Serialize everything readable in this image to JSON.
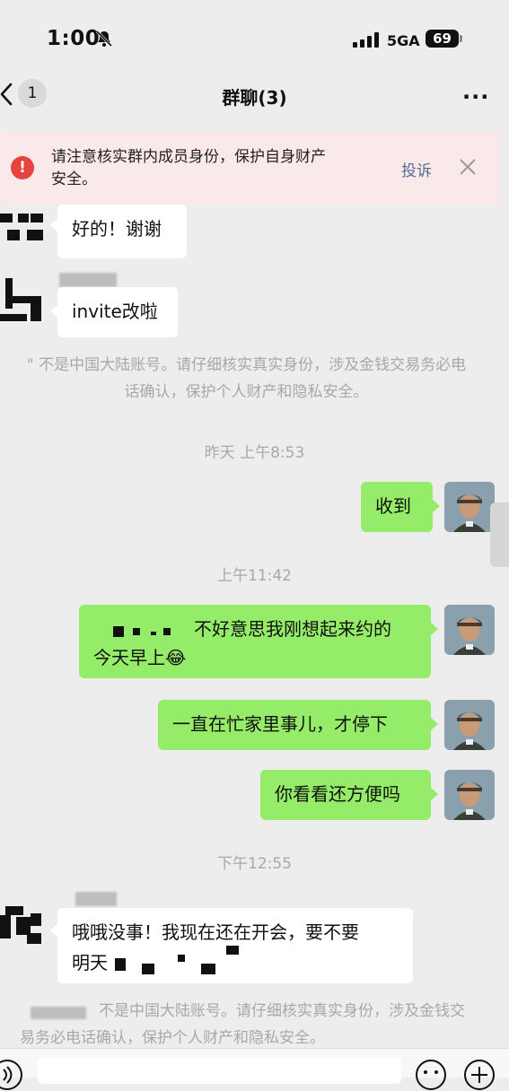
{
  "status_bar": {
    "time": "1:00",
    "network": "5GA",
    "battery": "69"
  },
  "nav": {
    "unread_count": "1",
    "title": "群聊(3)",
    "more": "···"
  },
  "warning": {
    "text": "请注意核实群内成员身份，保护自身财产安全。",
    "report": "投诉"
  },
  "messages": [
    {
      "side": "left",
      "text": "好的！谢谢"
    },
    {
      "side": "left",
      "text": "invite改啦"
    },
    {
      "side": "system_notice",
      "text": "\" 不是中国大陆账号。请仔细核实真实身份，涉及金钱交易务必电话确认，保护个人财产和隐私安全。"
    },
    {
      "side": "timestamp",
      "text": "昨天 上午8:53"
    },
    {
      "side": "right",
      "text": "收到"
    },
    {
      "side": "timestamp",
      "text": "上午11:42"
    },
    {
      "side": "right",
      "line1": "不好意思我刚想起来约的",
      "line2": "今天早上😂"
    },
    {
      "side": "right",
      "text": "一直在忙家里事儿，才停下"
    },
    {
      "side": "right",
      "text": "你看看还方便吗"
    },
    {
      "side": "timestamp",
      "text": "下午12:55"
    },
    {
      "side": "left",
      "line1": "哦哦没事！我现在还在开会，要不要",
      "line2": "明天"
    },
    {
      "side": "system_notice",
      "text": "不是中国大陆账号。请仔细核实真实身份，涉及金钱交易务必电话确认，保护个人财产和隐私安全。"
    }
  ],
  "icons": [
    "mute-bell-icon",
    "signal-icon",
    "back-chevron-icon",
    "more-icon",
    "alert-icon",
    "close-icon",
    "voice-icon",
    "emoji-icon",
    "plus-icon"
  ]
}
